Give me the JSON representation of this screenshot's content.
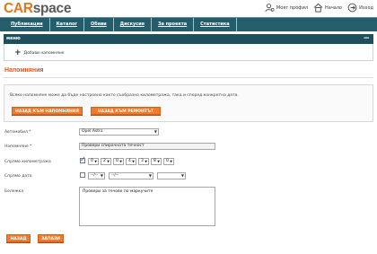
{
  "logo": {
    "part1": "CAR",
    "part2": "space"
  },
  "toplinks": [
    {
      "label": "Моят профил",
      "icon": "user-gear-icon"
    },
    {
      "label": "Начало",
      "icon": "home-icon"
    },
    {
      "label": "Изход",
      "icon": "logout-icon"
    }
  ],
  "nav": [
    "Публикации",
    "Каталог",
    "Обяви",
    "Дискусия",
    "За проекта",
    "Статистика"
  ],
  "menu": {
    "title": "меню",
    "collapse": "−",
    "add_label": "Добави напомняне"
  },
  "page": {
    "title": "Напомняния"
  },
  "info": {
    "text": "Всяко напомняне може да бъде настроено както съобразно километража, така и според конкретна дата.",
    "back_reminders": "НАЗАД КЪМ НАПОМНЯНИЯ",
    "back_repairs": "НАЗАД КЪМ РЕМОНТЪТ"
  },
  "form": {
    "car_label": "Автомобил *",
    "car_value": "Opel Astra",
    "reminder_label": "Напомняне *",
    "reminder_value": "Провери спирачната течност",
    "km_label": "Спрямо километража",
    "km_checked": true,
    "km_digits": [
      "0",
      "2",
      "0",
      "4",
      "3",
      "8",
      "0"
    ],
    "date_label": "Спрямо дата",
    "date_checked": false,
    "date_day": "--/--",
    "date_month": "--/--",
    "date_year": "",
    "notes_label": "Бележка",
    "notes_value": "Провери за течове по маркучите"
  },
  "buttons": {
    "back": "НАЗАД",
    "save": "ЗАПАЗИ"
  },
  "colors": {
    "accent": "#f07a2b",
    "nav": "#245d6b",
    "title": "#e2551d"
  }
}
